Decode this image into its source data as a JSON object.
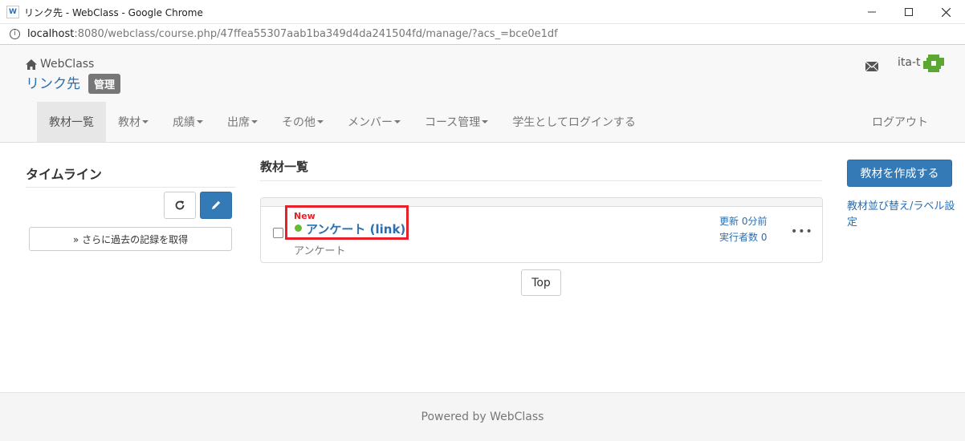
{
  "window": {
    "title": "リンク先 - WebClass - Google Chrome",
    "url_host": "localhost",
    "url_rest": ":8080/webclass/course.php/47ffea55307aab1ba349d4da241504fd/manage/?acs_=bce0e1df"
  },
  "header": {
    "brand_small": "WebClass",
    "course_title": "リンク先",
    "admin_badge": "管理",
    "user_name": "ita-t"
  },
  "menu": {
    "items": [
      {
        "label": "教材一覧",
        "dropdown": false
      },
      {
        "label": "教材",
        "dropdown": true
      },
      {
        "label": "成績",
        "dropdown": true
      },
      {
        "label": "出席",
        "dropdown": true
      },
      {
        "label": "その他",
        "dropdown": true
      },
      {
        "label": "メンバー",
        "dropdown": true
      },
      {
        "label": "コース管理",
        "dropdown": true
      },
      {
        "label": "学生としてログインする",
        "dropdown": false
      }
    ],
    "logout": "ログアウト"
  },
  "timeline": {
    "title": "タイムライン",
    "more_button": "» さらに過去の記録を取得"
  },
  "main": {
    "title": "教材一覧",
    "item": {
      "new_label": "New",
      "title": "アンケート (link)",
      "type": "アンケート",
      "updated": "更新 0分前",
      "runners": "実行者数 0",
      "menu_dots": "•••"
    },
    "top_button": "Top"
  },
  "side": {
    "create_button": "教材を作成する",
    "sort_link": "教材並び替え/ラベル設定"
  },
  "footer": {
    "text": "Powered by WebClass"
  },
  "colors": {
    "primary": "#337ab7",
    "link": "#2a6fb1",
    "highlight": "#e8202a",
    "status_dot": "#66bb33"
  }
}
